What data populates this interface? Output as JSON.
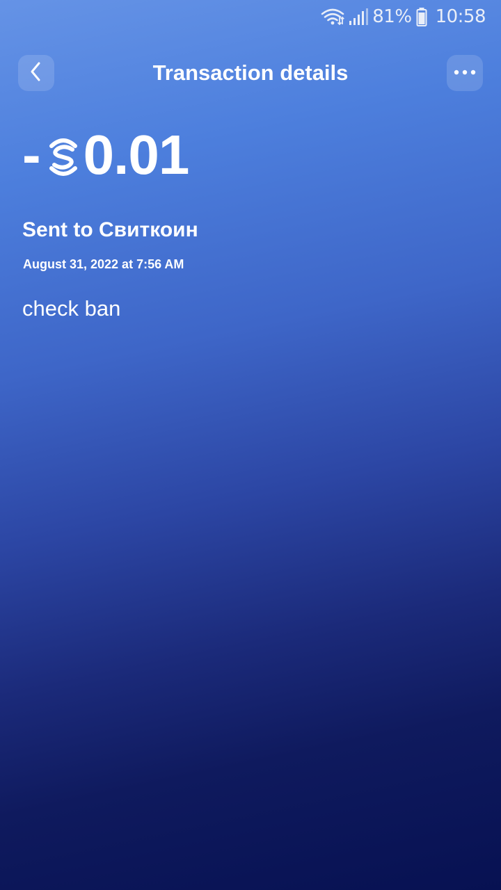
{
  "status_bar": {
    "wifi_icon": "wifi-icon",
    "signal_icon": "signal-icon",
    "battery_icon": "battery-icon",
    "battery": "81%",
    "time": "10:58"
  },
  "header": {
    "back_icon": "chevron-left-icon",
    "title": "Transaction details",
    "more_icon": "more-horizontal-icon"
  },
  "transaction": {
    "sign": "-",
    "currency_icon": "sweetcoin-icon",
    "amount": "0.01",
    "recipient": "Sent to Свиткоин",
    "date": "August 31, 2022 at 7:56 AM",
    "memo": "check ban"
  }
}
